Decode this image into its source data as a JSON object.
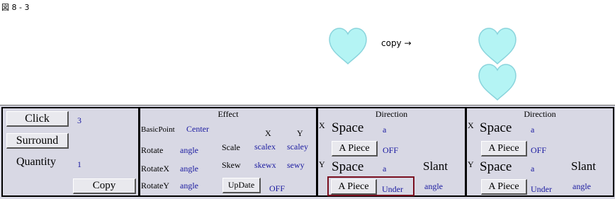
{
  "caption": "図 8 - 3",
  "copy_label": "copy →",
  "colors": {
    "heart_fill": "#b4f4f4",
    "heart_stroke": "#8ad4dc",
    "value_text": "#1a1aa0",
    "panel_bg": "#d8d8e4",
    "highlight": "#7a1020"
  },
  "left_panel": {
    "click_label": "Click",
    "click_value": "3",
    "surround_label": "Surround",
    "quantity_label": "Quantity",
    "quantity_value": "1",
    "copy_button": "Copy"
  },
  "effect_panel": {
    "title": "Effect",
    "basic_point_label": "BasicPoint",
    "basic_point_value": "Center",
    "x_header": "X",
    "y_header": "Y",
    "rotate_label": "Rotate",
    "rotate_value": "angle",
    "scale_label": "Scale",
    "scale_x": "scalex",
    "scale_y": "scaley",
    "rotatex_label": "RotateX",
    "rotatex_value": "angle",
    "skew_label": "Skew",
    "skew_x": "skewx",
    "skew_y": "sewy",
    "rotatey_label": "RotateY",
    "rotatey_value": "angle",
    "update_button": "UpDate",
    "update_value": "OFF"
  },
  "direction_panels": [
    {
      "title": "Direction",
      "x_axis": "X",
      "x_space": "Space",
      "x_space_value": "a",
      "x_piece_button": "A Piece",
      "x_piece_value": "OFF",
      "y_axis": "Y",
      "y_space": "Space",
      "y_space_value": "a",
      "slant_label": "Slant",
      "y_piece_button": "A Piece",
      "y_piece_value": "Under",
      "slant_value": "angle"
    },
    {
      "title": "Direction",
      "x_axis": "X",
      "x_space": "Space",
      "x_space_value": "a",
      "x_piece_button": "A Piece",
      "x_piece_value": "OFF",
      "y_axis": "Y",
      "y_space": "Space",
      "y_space_value": "a",
      "slant_label": "Slant",
      "y_piece_button": "A Piece",
      "y_piece_value": "Under",
      "slant_value": "angle"
    }
  ]
}
